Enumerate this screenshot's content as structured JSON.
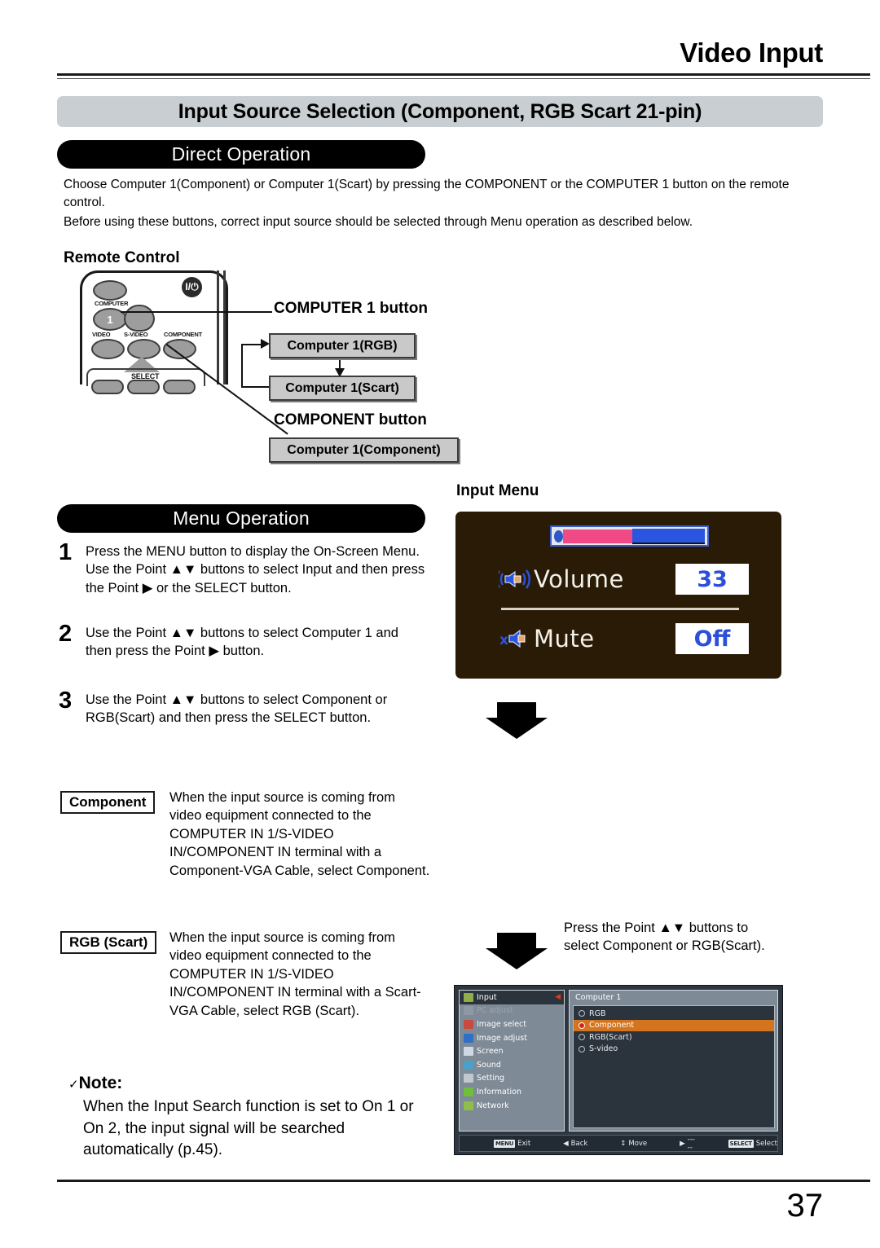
{
  "header": {
    "running_title": "Video Input",
    "section_band": "Input Source Selection (Component, RGB Scart 21-pin)"
  },
  "direct_operation": {
    "pill_label": "Direct Operation",
    "paragraph_1": "Choose Computer 1(Component) or Computer 1(Scart) by pressing the COMPONENT or the COMPUTER 1 button on the remote control.",
    "paragraph_2": "Before using these buttons, correct input source should be selected through Menu operation as described below.",
    "remote_control_heading": "Remote Control"
  },
  "remote": {
    "label_computer": "COMPUTER",
    "label_one": "1",
    "label_video": "VIDEO",
    "label_svideo": "S-VIDEO",
    "label_component": "COMPONENT",
    "label_select": "SELECT",
    "power_glyph": "I/⏻",
    "callout_computer1": "COMPUTER 1 button",
    "callout_component": "COMPONENT button",
    "box_rgb": "Computer 1(RGB)",
    "box_scart": "Computer 1(Scart)",
    "box_component": "Computer 1(Component)"
  },
  "menu_operation": {
    "pill_label": "Menu Operation",
    "steps": [
      {
        "num": "1",
        "text": "Press the MENU button to display the On-Screen Menu. Use the Point ▲▼ buttons to select Input and then press the Point ▶ or the SELECT button."
      },
      {
        "num": "2",
        "text": "Use the Point ▲▼ buttons to select Computer 1 and then press the Point ▶ button."
      },
      {
        "num": "3",
        "text": "Use the Point ▲▼ buttons to select Component or RGB(Scart) and then press the SELECT button."
      }
    ]
  },
  "input_menu": {
    "heading": "Input Menu",
    "rows": [
      {
        "icon": "speaker-waves-icon",
        "label": "Volume",
        "value": "33"
      },
      {
        "icon": "speaker-mute-icon",
        "label": "Mute",
        "value": "Off"
      }
    ],
    "slider_percent": 46,
    "colors": {
      "panel_bg": "#2a1b06",
      "slider_fill": "#ef4a85",
      "slider_rest": "#2a55e0",
      "value_text": "#2b4fd8"
    }
  },
  "definitions": [
    {
      "label": "Component",
      "text": "When the input source is coming from video equipment connected to the COMPUTER IN 1/S-VIDEO IN/COMPONENT IN terminal with a Component-VGA Cable, select Component."
    },
    {
      "label": "RGB (Scart)",
      "text": "When the input source is coming from video equipment connected to the COMPUTER IN 1/S-VIDEO IN/COMPONENT IN terminal with a Scart-VGA Cable, select RGB (Scart)."
    }
  ],
  "right_note": "Press the Point ▲▼ buttons to select Component or RGB(Scart).",
  "note": {
    "check": "✓",
    "title": "Note:",
    "body": "When the Input Search function is set to On 1 or On 2, the input signal will be searched automatically (p.45)."
  },
  "osd_screenshot": {
    "sidebar": [
      {
        "label": "Input",
        "icon": "input-icon",
        "state": "selected",
        "color": "#8fae4a"
      },
      {
        "label": "PC adjust",
        "icon": "monitor-icon",
        "state": "disabled",
        "color": "#8d99a5"
      },
      {
        "label": "Image select",
        "icon": "image-select-icon",
        "state": "normal",
        "color": "#c94b3d"
      },
      {
        "label": "Image adjust",
        "icon": "image-adjust-icon",
        "state": "normal",
        "color": "#2f6fc4"
      },
      {
        "label": "Screen",
        "icon": "screen-icon",
        "state": "normal",
        "color": "#cfd9e4"
      },
      {
        "label": "Sound",
        "icon": "sound-icon",
        "state": "normal",
        "color": "#4aa0c9"
      },
      {
        "label": "Setting",
        "icon": "setting-icon",
        "state": "normal",
        "color": "#c0c7ce"
      },
      {
        "label": "Information",
        "icon": "information-icon",
        "state": "normal",
        "color": "#6fbf3a"
      },
      {
        "label": "Network",
        "icon": "network-icon",
        "state": "normal",
        "color": "#8fbf4a"
      }
    ],
    "panel_title": "Computer 1",
    "options": [
      {
        "label": "RGB",
        "selected": false
      },
      {
        "label": "Component",
        "selected": true
      },
      {
        "label": "RGB(Scart)",
        "selected": false
      },
      {
        "label": "S-video",
        "selected": false
      }
    ],
    "bottom_bar": [
      {
        "key": "MENU",
        "label": "Exit"
      },
      {
        "key": "◀",
        "label": "Back"
      },
      {
        "key": "↕",
        "label": "Move"
      },
      {
        "key": "▶",
        "label": "-----"
      },
      {
        "key": "SELECT",
        "label": "Select"
      }
    ],
    "highlight_color": "#d4741e"
  },
  "footer": {
    "page_number": "37"
  }
}
